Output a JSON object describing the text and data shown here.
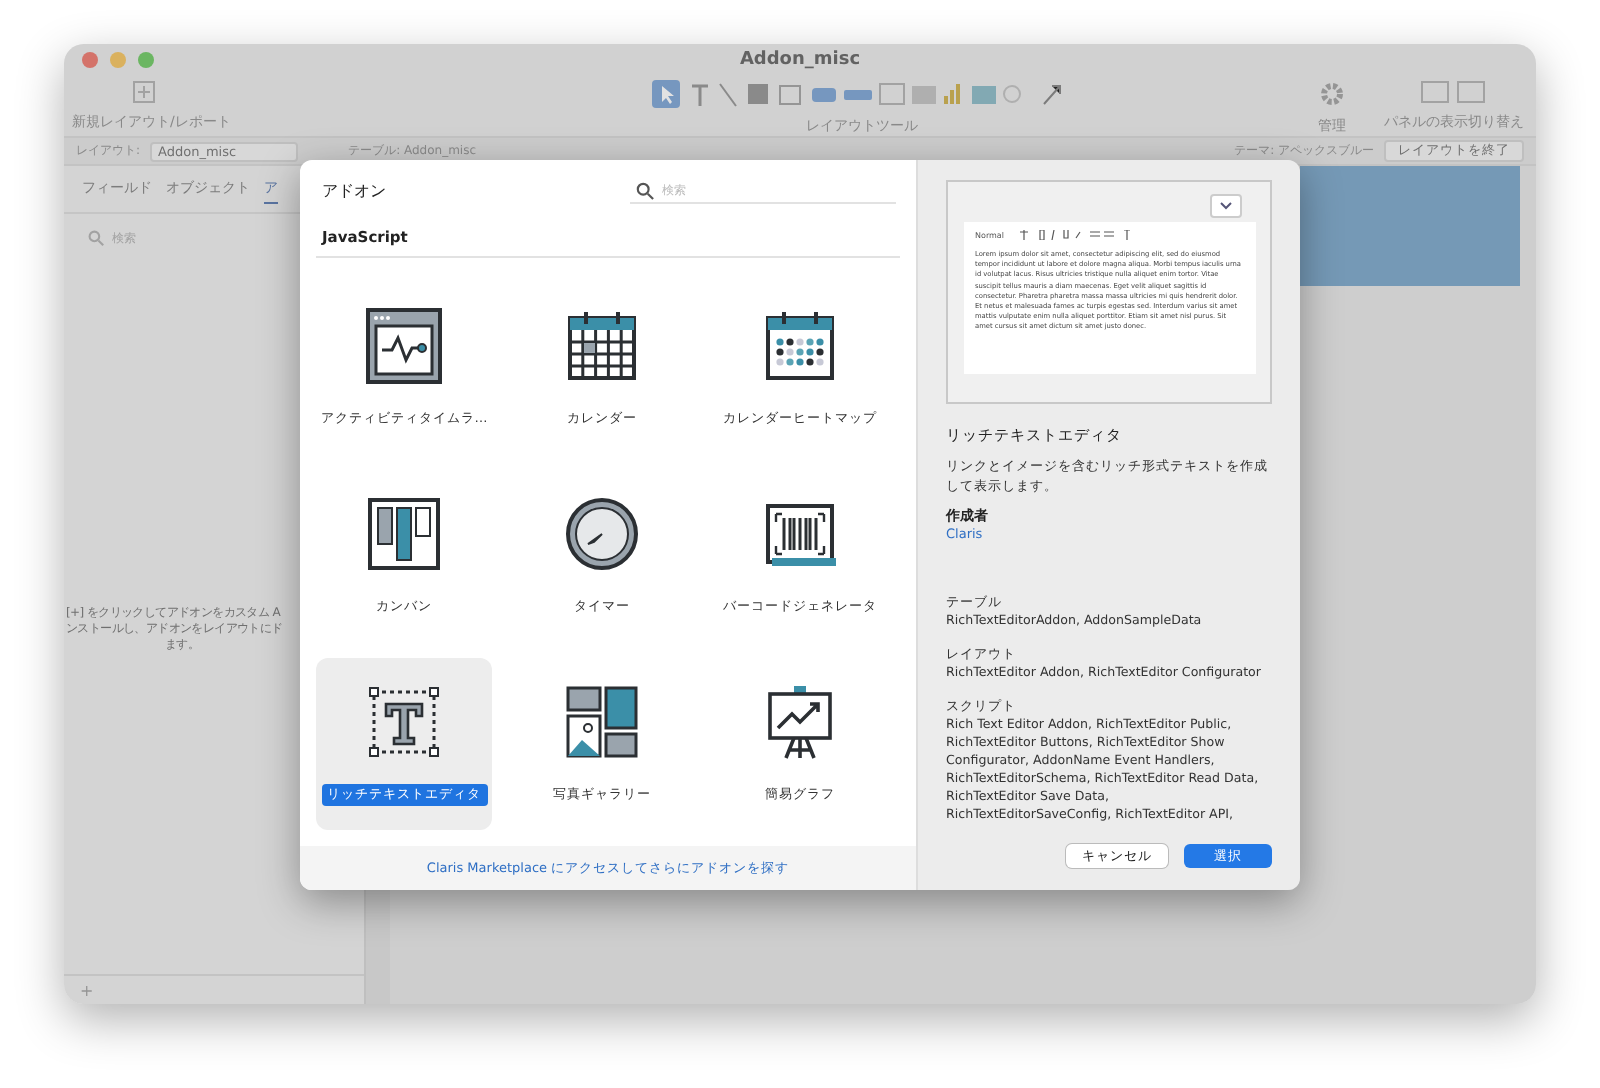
{
  "window": {
    "title": "Addon_misc"
  },
  "toolbar": {
    "left_label": "新規レイアウト/レポート",
    "center_label": "レイアウトツール",
    "manage_label": "管理",
    "panel_label": "パネルの表示切り替え"
  },
  "layout_bar": {
    "layout_label": "レイアウト:",
    "layout_value": "Addon_misc",
    "table_label": "テーブル: Addon_misc",
    "theme_label": "テーマ: アペックスブルー",
    "exit_button": "レイアウトを終了"
  },
  "side_panel": {
    "tabs": [
      {
        "label": "フィールド",
        "selected": false
      },
      {
        "label": "オブジェクト",
        "selected": false
      },
      {
        "label": "ア",
        "selected": true
      }
    ],
    "search": {
      "placeholder": "検索"
    },
    "hint_lines": [
      "[+] をクリックしてアドオンをカスタム A",
      "ンストールし、アドオンをレイアウトにド",
      "ます。"
    ],
    "add_button": "+"
  },
  "dialog": {
    "title": "アドオン",
    "search": {
      "placeholder": "検索"
    },
    "section": "JavaScript",
    "items": [
      {
        "label": "アクティビティタイムラ…",
        "selected": false
      },
      {
        "label": "カレンダー",
        "selected": false
      },
      {
        "label": "カレンダーヒートマップ",
        "selected": false
      },
      {
        "label": "カンバン",
        "selected": false
      },
      {
        "label": "タイマー",
        "selected": false
      },
      {
        "label": "バーコードジェネレータ",
        "selected": false
      },
      {
        "label": "リッチテキストエディタ",
        "selected": true
      },
      {
        "label": "写真ギャラリー",
        "selected": false
      },
      {
        "label": "簡易グラフ",
        "selected": false
      }
    ],
    "marketplace_link": "Claris Marketplace にアクセスしてさらにアドオンを探す",
    "preview": {
      "format": "Normal",
      "text": "Lorem ipsum dolor sit amet, consectetur adipiscing elit, sed do eiusmod tempor incididunt ut labore et dolore magna aliqua. Morbi tempus iaculis urna id volutpat lacus. Risus ultricies tristique nulla aliquet enim tortor. Vitae suscipit tellus mauris a diam maecenas. Eget velit aliquet sagittis id consectetur. Pharetra pharetra massa massa ultricies mi quis hendrerit dolor. Et netus et malesuada fames ac turpis egestas sed. Interdum varius sit amet mattis vulputate enim nulla aliquet porttitor. Etiam sit amet nisl purus. Sit amet cursus sit amet dictum sit amet justo donec."
    },
    "detail": {
      "name": "リッチテキストエディタ",
      "description": "リンクとイメージを含むリッチ形式テキストを作成して表示します。",
      "author_label": "作成者",
      "author": "Claris",
      "sections": [
        {
          "heading": "テーブル",
          "body": "RichTextEditorAddon, AddonSampleData"
        },
        {
          "heading": "レイアウト",
          "body": "RichTextEditor Addon, RichTextEditor Configurator"
        },
        {
          "heading": "スクリプト",
          "body": "Rich Text Editor Addon, RichTextEditor Public, RichTextEditor Buttons, RichTextEditor Show Configurator, AddonName Event Handlers, RichTextEditorSchema, RichTextEditor Read Data, RichTextEditor Save Data, RichTextEditorSaveConfig, RichTextEditor API,"
        }
      ]
    },
    "buttons": [
      {
        "label": "キャンセル",
        "kind": "secondary"
      },
      {
        "label": "選択",
        "kind": "primary"
      }
    ]
  }
}
